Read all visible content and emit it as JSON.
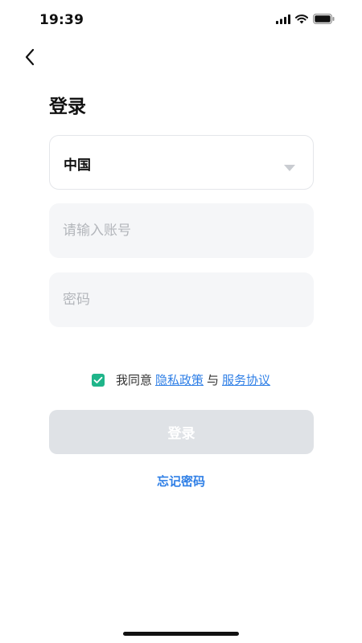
{
  "status_bar": {
    "time": "19:39"
  },
  "header": {
    "title": "登录"
  },
  "form": {
    "country": "中国",
    "account_placeholder": "请输入账号",
    "account_value": "",
    "password_placeholder": "密码",
    "password_value": ""
  },
  "agreement": {
    "checked": true,
    "prefix": "我同意",
    "privacy_link": "隐私政策",
    "joiner": "与",
    "terms_link": "服务协议"
  },
  "actions": {
    "login_label": "登录",
    "forgot_label": "忘记密码"
  },
  "colors": {
    "accent": "#2f7fe6",
    "checkbox": "#1fb58a",
    "disabled_button": "#dfe2e6",
    "input_bg": "#f5f6f8"
  },
  "icons": {
    "back": "chevron-left-icon",
    "signal": "signal-icon",
    "wifi": "wifi-icon",
    "battery": "battery-icon",
    "dropdown": "caret-down-icon",
    "check": "checkmark-icon"
  }
}
